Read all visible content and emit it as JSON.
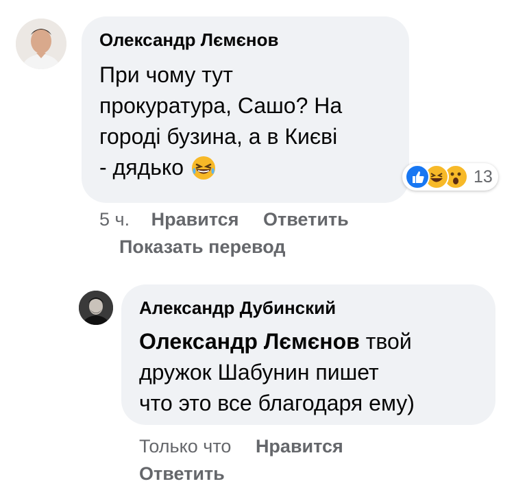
{
  "comment1": {
    "author": "Олександр Лємєнов",
    "text_lines": [
      "При чому тут",
      "прокуратура, Сашо? На",
      "городі бузина, а в Києві",
      "- дядько"
    ],
    "emoji_icon": "laughing-face-icon",
    "reactions": {
      "icons": [
        "like-icon",
        "haha-icon",
        "wow-icon"
      ],
      "count": "13"
    },
    "time": "5 ч.",
    "like_label": "Нравится",
    "reply_label": "Ответить",
    "translate_label": "Показать перевод"
  },
  "comment2": {
    "author": "Александр Дубинский",
    "mention": "Олександр Лємєнов",
    "text_after_mention": " твой",
    "text_lines": [
      "дружок Шабунин пишет",
      "что это все благодаря ему)"
    ],
    "time": "Только что",
    "like_label": "Нравится",
    "reply_label": "Ответить"
  },
  "colors": {
    "bubble": "#f0f2f5",
    "meta_text": "#65676b",
    "like_blue": "#1877f2",
    "emoji_yellow": "#f7b928"
  }
}
